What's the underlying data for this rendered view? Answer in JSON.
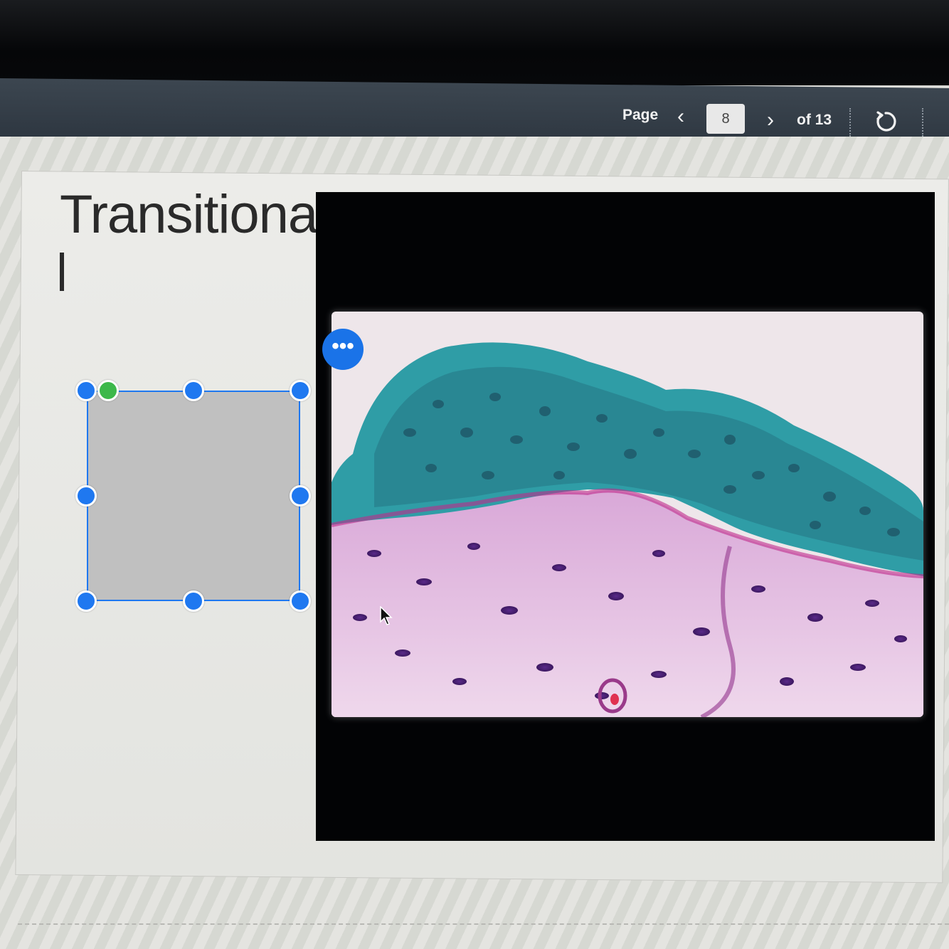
{
  "toolbar": {
    "page_label": "Page",
    "prev_icon": "chevron-left-icon",
    "current_page": "8",
    "next_icon": "chevron-right-icon",
    "page_total": "of 13",
    "refresh_icon": "refresh-icon"
  },
  "slide": {
    "title": "Transitiona",
    "caret_line": "I",
    "image": "microscope-image",
    "more_button_label": "•••",
    "selected_shape": "rectangle",
    "shape_fill": "#c0c0c0",
    "selection_color": "#1f78f0",
    "rotate_handle_color": "#3cb84a"
  }
}
